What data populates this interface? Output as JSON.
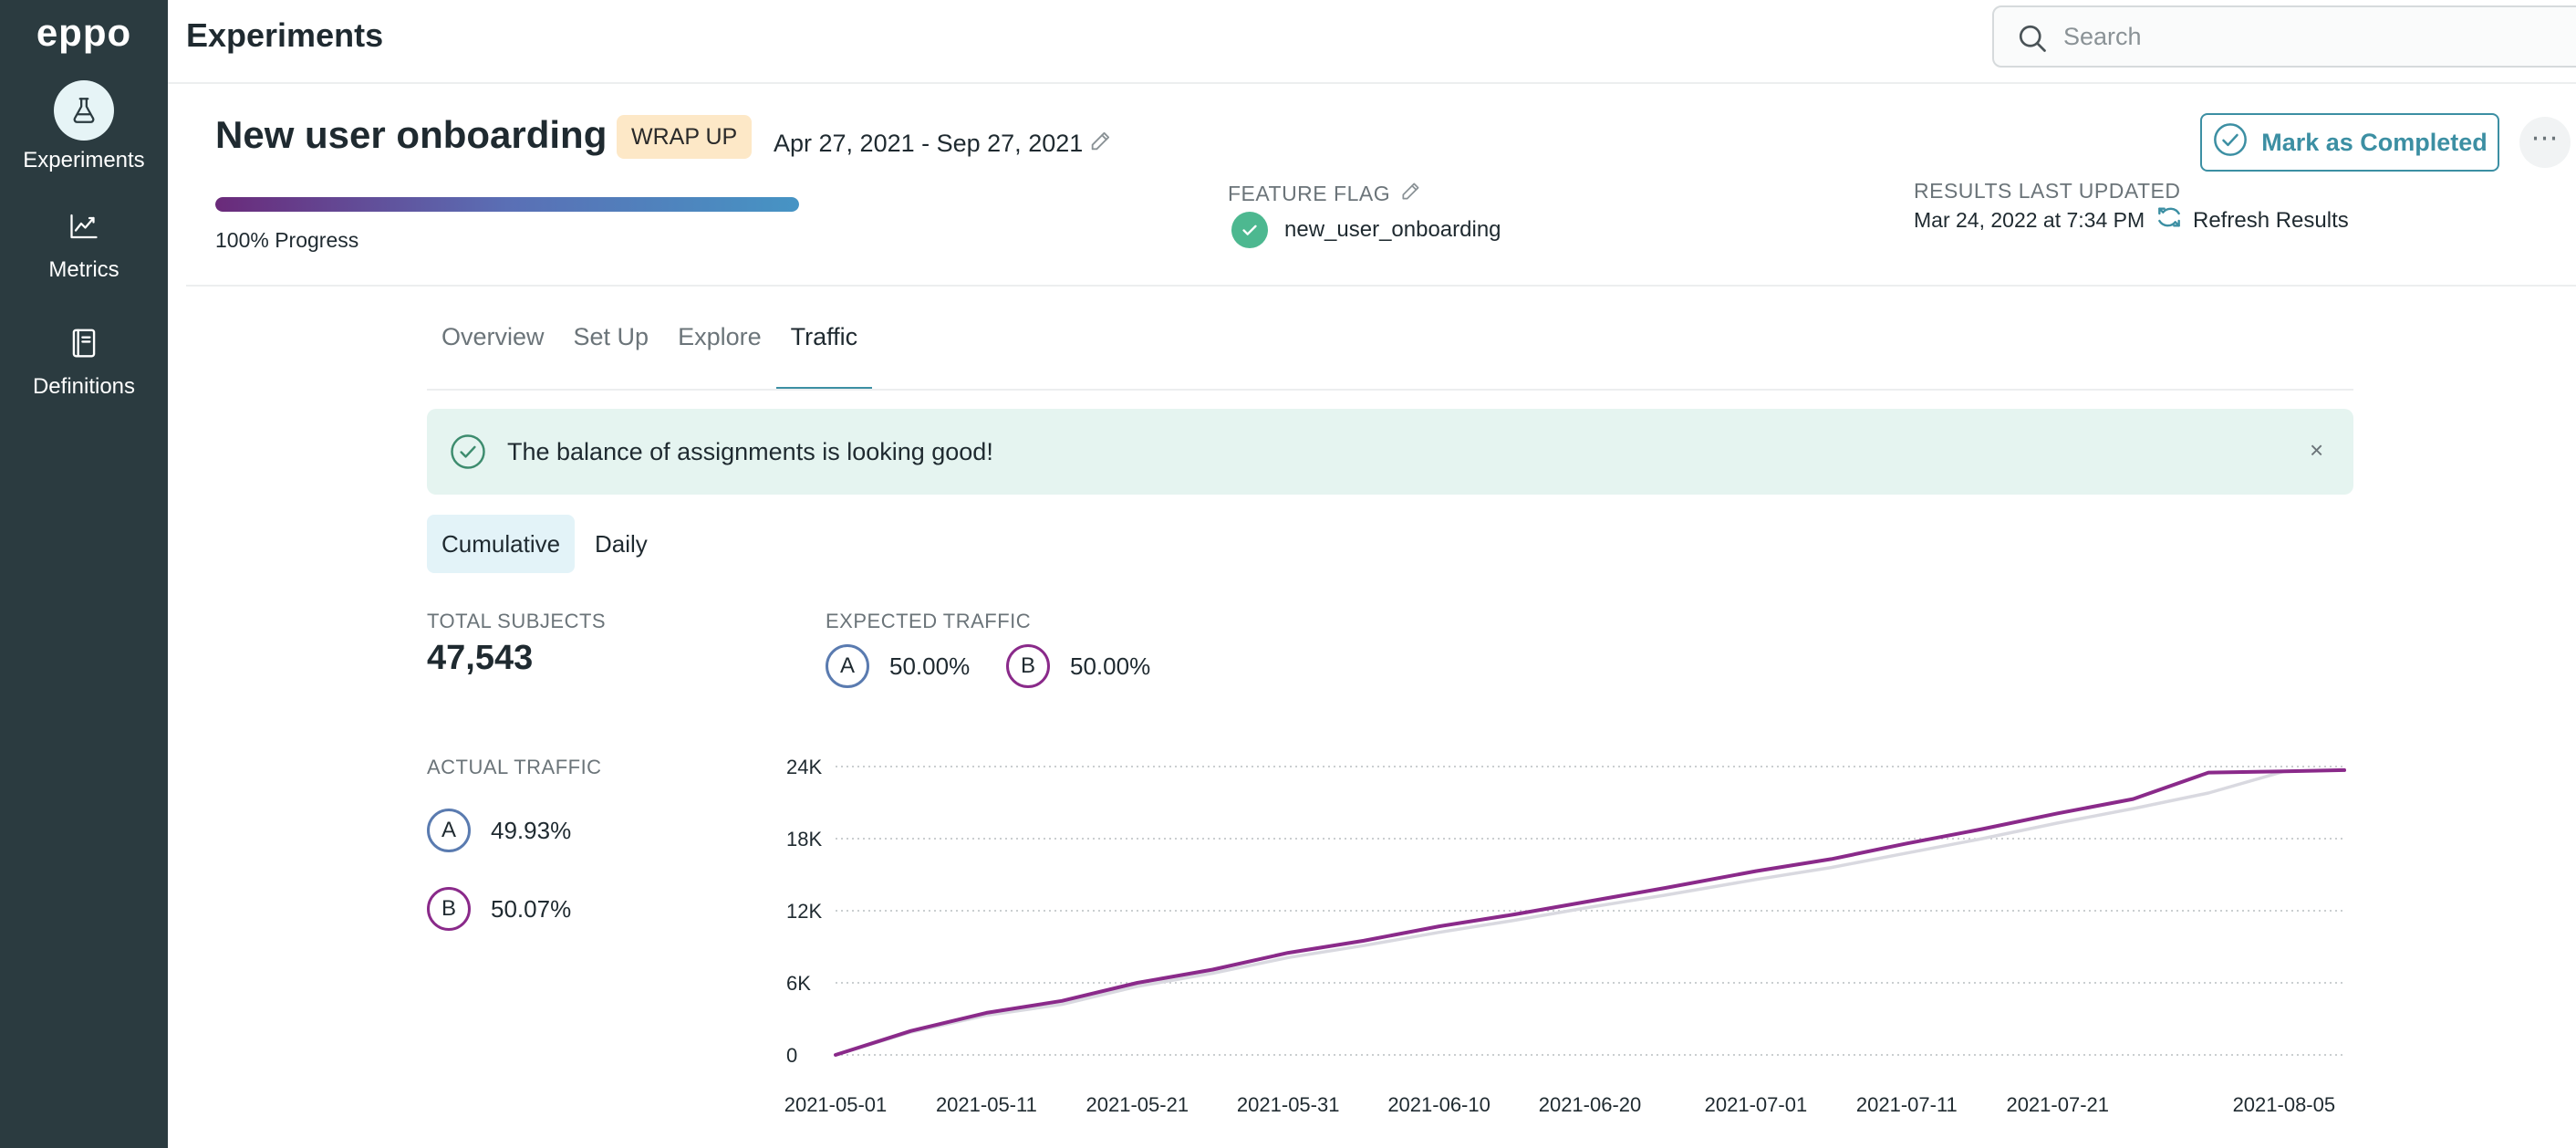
{
  "app": {
    "logo": "eppo"
  },
  "sidebar": {
    "items": [
      {
        "label": "Experiments",
        "icon": "flask-icon",
        "active": true
      },
      {
        "label": "Metrics",
        "icon": "trend-chart-icon",
        "active": false
      },
      {
        "label": "Definitions",
        "icon": "book-icon",
        "active": false
      }
    ]
  },
  "header": {
    "title": "Experiments",
    "search_placeholder": "Search"
  },
  "experiment": {
    "name": "New user onboarding",
    "status": "WRAP UP",
    "date_range": "Apr 27, 2021 - Sep 27, 2021",
    "progress_label": "100% Progress",
    "progress_fraction": 1.0,
    "feature_flag_label": "FEATURE FLAG",
    "feature_flag_value": "new_user_onboarding",
    "results_label": "RESULTS LAST UPDATED",
    "results_date": "Mar 24, 2022 at 7:34 PM",
    "refresh_label": "Refresh Results",
    "complete_label": "Mark as Completed"
  },
  "tabs": [
    {
      "label": "Overview",
      "active": false
    },
    {
      "label": "Set Up",
      "active": false
    },
    {
      "label": "Explore",
      "active": false
    },
    {
      "label": "Traffic",
      "active": true
    }
  ],
  "alert": {
    "text": "The balance of assignments is looking good!",
    "close": "×"
  },
  "toggle": {
    "cumulative": "Cumulative",
    "daily": "Daily",
    "selected": "Cumulative"
  },
  "stats": {
    "total_label": "TOTAL SUBJECTS",
    "total_value": "47,543",
    "expected_label": "EXPECTED TRAFFIC",
    "expected": [
      {
        "variant": "A",
        "value": "50.00%"
      },
      {
        "variant": "B",
        "value": "50.00%"
      }
    ],
    "actual_label": "ACTUAL TRAFFIC",
    "actual": [
      {
        "variant": "A",
        "value": "49.93%"
      },
      {
        "variant": "B",
        "value": "50.07%"
      }
    ]
  },
  "colors": {
    "sidebar_bg": "#2b3b40",
    "accent": "#3c8fa3",
    "variant_a": "#5a7bb0",
    "variant_b": "#8a2a8a",
    "badge_bg": "#fde8c7",
    "alert_bg": "#e5f4f0",
    "success": "#4db890"
  },
  "chart_data": {
    "type": "line",
    "title": "",
    "xlabel": "",
    "ylabel": "",
    "y_ticks": [
      0,
      6000,
      12000,
      18000,
      24000
    ],
    "y_tick_labels": [
      "0",
      "6K",
      "12K",
      "18K",
      "24K"
    ],
    "ylim": [
      0,
      24000
    ],
    "x_ticks": [
      "2021-05-01",
      "2021-05-11",
      "2021-05-21",
      "2021-05-31",
      "2021-06-10",
      "2021-06-20",
      "2021-07-01",
      "2021-07-11",
      "2021-07-21",
      "2021-08-05"
    ],
    "xlim": [
      "2021-05-01",
      "2021-08-09"
    ],
    "grid": true,
    "series": [
      {
        "variant": "A",
        "color": "#d9d9e0",
        "points": [
          [
            "2021-05-01",
            0
          ],
          [
            "2021-05-06",
            1900
          ],
          [
            "2021-05-11",
            3300
          ],
          [
            "2021-05-16",
            4200
          ],
          [
            "2021-05-21",
            5700
          ],
          [
            "2021-05-26",
            6800
          ],
          [
            "2021-05-31",
            8100
          ],
          [
            "2021-06-05",
            9100
          ],
          [
            "2021-06-10",
            10200
          ],
          [
            "2021-06-15",
            11200
          ],
          [
            "2021-06-20",
            12300
          ],
          [
            "2021-06-25",
            13300
          ],
          [
            "2021-07-01",
            14600
          ],
          [
            "2021-07-06",
            15600
          ],
          [
            "2021-07-11",
            16800
          ],
          [
            "2021-07-16",
            18000
          ],
          [
            "2021-07-21",
            19300
          ],
          [
            "2021-07-26",
            20500
          ],
          [
            "2021-07-31",
            21800
          ],
          [
            "2021-08-05",
            23600
          ],
          [
            "2021-08-09",
            23700
          ]
        ]
      },
      {
        "variant": "B",
        "color": "#8a2a8a",
        "points": [
          [
            "2021-05-01",
            0
          ],
          [
            "2021-05-06",
            2000
          ],
          [
            "2021-05-11",
            3500
          ],
          [
            "2021-05-16",
            4500
          ],
          [
            "2021-05-21",
            6000
          ],
          [
            "2021-05-26",
            7100
          ],
          [
            "2021-05-31",
            8500
          ],
          [
            "2021-06-05",
            9500
          ],
          [
            "2021-06-10",
            10700
          ],
          [
            "2021-06-15",
            11700
          ],
          [
            "2021-06-20",
            12800
          ],
          [
            "2021-06-25",
            13900
          ],
          [
            "2021-07-01",
            15300
          ],
          [
            "2021-07-06",
            16300
          ],
          [
            "2021-07-11",
            17600
          ],
          [
            "2021-07-16",
            18800
          ],
          [
            "2021-07-21",
            20100
          ],
          [
            "2021-07-26",
            21300
          ],
          [
            "2021-07-31",
            23500
          ],
          [
            "2021-08-05",
            23600
          ],
          [
            "2021-08-09",
            23700
          ]
        ]
      }
    ]
  }
}
